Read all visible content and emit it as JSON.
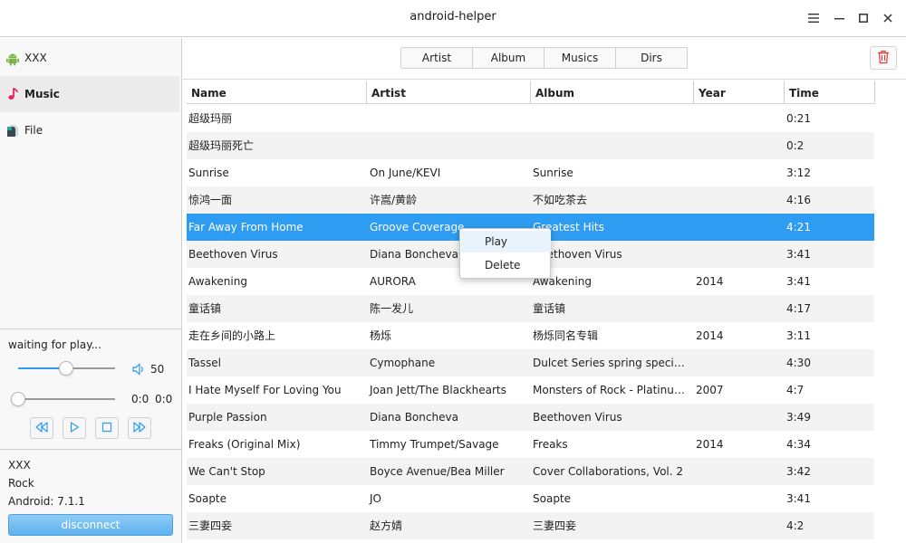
{
  "window": {
    "title": "android-helper",
    "menu_icon": "hamburger-icon",
    "minimize_icon": "minimize-icon",
    "maximize_icon": "maximize-icon",
    "close_icon": "close-icon"
  },
  "sidebar": {
    "items": [
      {
        "label": "XXX",
        "icon": "android-icon",
        "active": false
      },
      {
        "label": "Music",
        "icon": "music-note-icon",
        "active": true
      },
      {
        "label": "File",
        "icon": "file-icon",
        "active": false
      }
    ]
  },
  "player": {
    "status": "waiting for play...",
    "volume": "50",
    "volume_level": 0.5,
    "position_level": 0,
    "current_time": "0:0",
    "total_time": "0:0",
    "controls": [
      "rewind-icon",
      "play-icon",
      "stop-icon",
      "fast-forward-icon"
    ]
  },
  "device": {
    "name": "XXX",
    "model": "Rock",
    "android_version": "Android: 7.1.1",
    "disconnect_label": "disconnect"
  },
  "tabs": [
    "Artist",
    "Album",
    "Musics",
    "Dirs"
  ],
  "delete_icon": "trash-icon",
  "table": {
    "headers": [
      "Name",
      "Artist",
      "Album",
      "Year",
      "Time"
    ],
    "rows": [
      {
        "name": "超级玛丽",
        "artist": "",
        "album": "",
        "year": "",
        "time": "0:21"
      },
      {
        "name": "超级玛丽死亡",
        "artist": "",
        "album": "",
        "year": "",
        "time": "0:2"
      },
      {
        "name": "Sunrise",
        "artist": "On June/KEVI",
        "album": "Sunrise",
        "year": "",
        "time": "3:12"
      },
      {
        "name": "惊鸿一面",
        "artist": "许嵩/黄龄",
        "album": "不如吃茶去",
        "year": "",
        "time": "4:16"
      },
      {
        "name": "Far Away From Home",
        "artist": "Groove Coverage",
        "album": "Greatest Hits",
        "year": "",
        "time": "4:21",
        "selected": true
      },
      {
        "name": "Beethoven Virus",
        "artist": "Diana Boncheva",
        "album": "Beethoven Virus",
        "year": "",
        "time": "3:41"
      },
      {
        "name": "Awakening",
        "artist": "AURORA",
        "album": "Awakening",
        "year": "2014",
        "time": "3:41"
      },
      {
        "name": "童话镇",
        "artist": "陈一发儿",
        "album": "童话镇",
        "year": "",
        "time": "4:17"
      },
      {
        "name": "走在乡间的小路上",
        "artist": "杨烁",
        "album": "杨烁同名专辑",
        "year": "2014",
        "time": "3:11"
      },
      {
        "name": "Tassel",
        "artist": "Cymophane",
        "album": "Dulcet Series spring special co…",
        "year": "",
        "time": "4:30"
      },
      {
        "name": "I Hate Myself For Loving You",
        "artist": "Joan Jett/The Blackhearts",
        "album": "Monsters of Rock - Platinum E…",
        "year": "2007",
        "time": "4:7"
      },
      {
        "name": "Purple Passion",
        "artist": "Diana Boncheva",
        "album": "Beethoven Virus",
        "year": "",
        "time": "3:49"
      },
      {
        "name": "Freaks (Original Mix)",
        "artist": "Timmy Trumpet/Savage",
        "album": "Freaks",
        "year": "2014",
        "time": "4:34"
      },
      {
        "name": "We Can't Stop",
        "artist": "Boyce Avenue/Bea Miller",
        "album": "Cover Collaborations, Vol. 2",
        "year": "",
        "time": "3:42"
      },
      {
        "name": "Soapte",
        "artist": "JO",
        "album": "Soapte",
        "year": "",
        "time": "3:41"
      },
      {
        "name": "三妻四妾",
        "artist": "赵方婧",
        "album": "三妻四妾",
        "year": "",
        "time": "4:2"
      }
    ]
  },
  "context_menu": {
    "items": [
      "Play",
      "Delete"
    ]
  },
  "colors": {
    "accent": "#2e9cf0",
    "row_alt": "#f3f3f3",
    "android_green": "#7cb342",
    "music_pink": "#e91e63",
    "delete_red": "#e53935"
  }
}
